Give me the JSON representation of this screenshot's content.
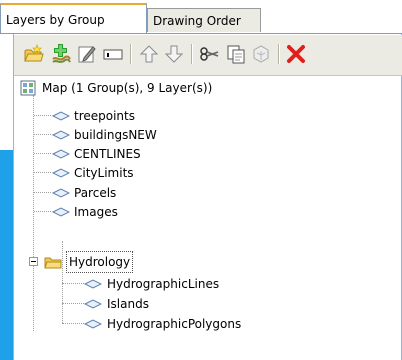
{
  "tabs": [
    {
      "label": "Layers by Group",
      "active": true
    },
    {
      "label": "Drawing Order",
      "active": false
    }
  ],
  "toolbar": {
    "buttons": [
      {
        "icon": "new-group-icon"
      },
      {
        "icon": "add-layer-icon"
      },
      {
        "icon": "edit-properties-icon"
      },
      {
        "icon": "rename-icon"
      },
      {
        "icon": "move-up-icon"
      },
      {
        "icon": "move-down-icon"
      },
      {
        "icon": "cut-icon"
      },
      {
        "icon": "copy-icon"
      },
      {
        "icon": "paste-icon"
      },
      {
        "icon": "delete-icon"
      }
    ],
    "colors": {
      "delete": "#e0201b",
      "folder": "#f2c94c",
      "plus": "#2e9c2e"
    }
  },
  "tree": {
    "root": {
      "label": "Map (1 Group(s), 9 Layer(s))",
      "icon": "map-icon"
    },
    "layers": [
      {
        "label": "treepoints"
      },
      {
        "label": "buildingsNEW"
      },
      {
        "label": "CENTLINES"
      },
      {
        "label": "CityLimits"
      },
      {
        "label": "Parcels"
      },
      {
        "label": "Images"
      }
    ],
    "group": {
      "label": "Hydrology",
      "expanded": true,
      "selected": true,
      "children": [
        {
          "label": "HydrographicLines"
        },
        {
          "label": "Islands"
        },
        {
          "label": "HydrographicPolygons"
        }
      ]
    }
  },
  "accent_color": "#1ea1e8"
}
